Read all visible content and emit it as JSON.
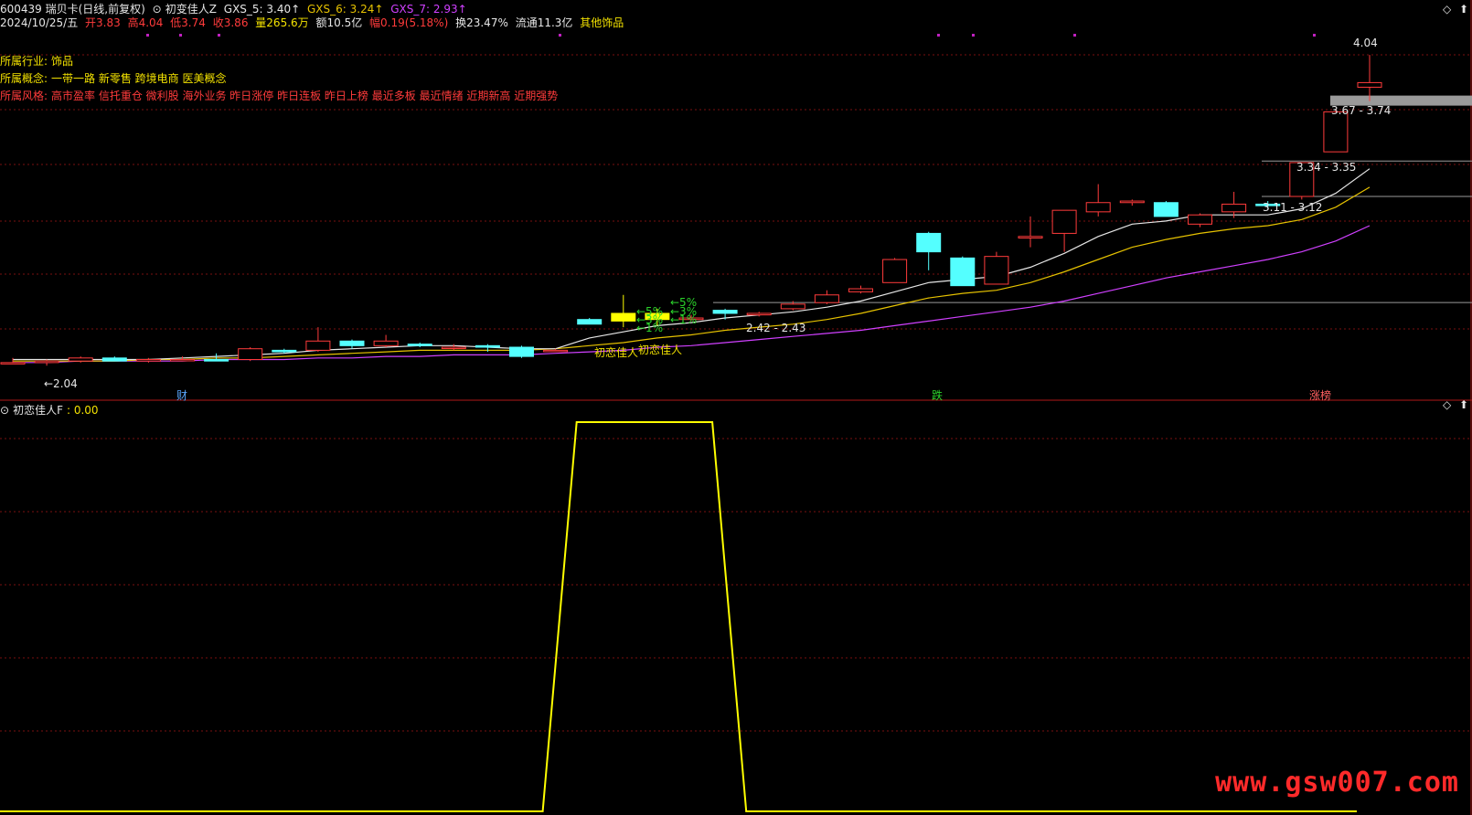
{
  "header": {
    "code_name": "600439 瑞贝卡(日线,前复权)",
    "indicator_name": "初变佳人Z",
    "gxs5": "GXS_5: 3.40↑",
    "gxs6": "GXS_6: 3.24↑",
    "gxs7": "GXS_7: 2.93↑",
    "date": "2024/10/25/五",
    "open": "开3.83",
    "high": "高4.04",
    "low": "低3.74",
    "close": "收3.86",
    "volume": "量265.6万",
    "amount": "额10.5亿",
    "change": "幅0.19(5.18%)",
    "turnover": "换23.47%",
    "float_cap": "流通11.3亿",
    "sector": "其他饰品"
  },
  "info": {
    "industry_label": "所属行业:",
    "industry": "饰品",
    "concept_label": "所属概念:",
    "concepts": "一带一路 新零售 跨境电商 医美概念",
    "style_label": "所属风格:",
    "styles": "高市盈率 信托重仓 微利股 海外业务 昨日涨停 昨日连板 昨日上榜 最近多板 最近情绪 近期新高 近期强势"
  },
  "annotations": {
    "price_top": "4.04",
    "price_low": "←2.04",
    "range_a": "3.67 - 3.74",
    "range_b": "3.34 - 3.35",
    "range_c": "3.11 - 3.12",
    "range_d": "2.42 - 2.43",
    "signal_label": "初恋佳人",
    "signal_label2": "初恋佳人",
    "pct_a": "←5%",
    "pct_b": "←3%",
    "pct_c": "←5%",
    "pct_d": "←3%",
    "pct_e": "←1%",
    "pct_f": "←1%",
    "marker_cai": "财",
    "marker_die": "跌",
    "marker_zhang": "涨榜"
  },
  "sub_panel": {
    "title": "初恋佳人F",
    "value": ": 0.00"
  },
  "watermark": "www.gsw007.com",
  "colors": {
    "up": "#ff3b3b",
    "down": "#54ffff",
    "signal": "#ffff00",
    "ma5": "#e6e6e6",
    "ma6": "#e6c200",
    "ma7": "#d040ff"
  },
  "chart_data": {
    "type": "candlestick",
    "price_range": [
      1.95,
      4.1
    ],
    "candles": [
      {
        "o": 2.04,
        "h": 2.07,
        "l": 2.03,
        "c": 2.04
      },
      {
        "o": 2.04,
        "h": 2.06,
        "l": 2.02,
        "c": 2.05
      },
      {
        "o": 2.05,
        "h": 2.08,
        "l": 2.04,
        "c": 2.07
      },
      {
        "o": 2.07,
        "h": 2.08,
        "l": 2.05,
        "c": 2.05
      },
      {
        "o": 2.05,
        "h": 2.07,
        "l": 2.04,
        "c": 2.06
      },
      {
        "o": 2.06,
        "h": 2.08,
        "l": 2.05,
        "c": 2.06
      },
      {
        "o": 2.06,
        "h": 2.1,
        "l": 2.05,
        "c": 2.05
      },
      {
        "o": 2.06,
        "h": 2.14,
        "l": 2.05,
        "c": 2.13
      },
      {
        "o": 2.12,
        "h": 2.13,
        "l": 2.1,
        "c": 2.11
      },
      {
        "o": 2.12,
        "h": 2.27,
        "l": 2.11,
        "c": 2.18
      },
      {
        "o": 2.18,
        "h": 2.19,
        "l": 2.13,
        "c": 2.15
      },
      {
        "o": 2.15,
        "h": 2.22,
        "l": 2.14,
        "c": 2.18
      },
      {
        "o": 2.16,
        "h": 2.17,
        "l": 2.14,
        "c": 2.15
      },
      {
        "o": 2.14,
        "h": 2.16,
        "l": 2.12,
        "c": 2.14
      },
      {
        "o": 2.15,
        "h": 2.16,
        "l": 2.11,
        "c": 2.14
      },
      {
        "o": 2.14,
        "h": 2.15,
        "l": 2.07,
        "c": 2.08
      },
      {
        "o": 2.12,
        "h": 2.13,
        "l": 2.12,
        "c": 2.12
      },
      {
        "o": 2.32,
        "h": 2.33,
        "l": 2.29,
        "c": 2.29
      },
      {
        "o": 2.36,
        "h": 2.48,
        "l": 2.27,
        "c": 2.31
      },
      {
        "o": 2.36,
        "h": 2.39,
        "l": 2.28,
        "c": 2.32
      },
      {
        "o": 2.32,
        "h": 2.35,
        "l": 2.31,
        "c": 2.33
      },
      {
        "o": 2.38,
        "h": 2.39,
        "l": 2.32,
        "c": 2.36
      },
      {
        "o": 2.35,
        "h": 2.37,
        "l": 2.34,
        "c": 2.36
      },
      {
        "o": 2.39,
        "h": 2.44,
        "l": 2.38,
        "c": 2.42
      },
      {
        "o": 2.43,
        "h": 2.51,
        "l": 2.42,
        "c": 2.48
      },
      {
        "o": 2.5,
        "h": 2.54,
        "l": 2.49,
        "c": 2.52
      },
      {
        "o": 2.56,
        "h": 2.72,
        "l": 2.56,
        "c": 2.71
      },
      {
        "o": 2.88,
        "h": 2.89,
        "l": 2.64,
        "c": 2.76
      },
      {
        "o": 2.72,
        "h": 2.73,
        "l": 2.54,
        "c": 2.54
      },
      {
        "o": 2.55,
        "h": 2.76,
        "l": 2.55,
        "c": 2.73
      },
      {
        "o": 2.85,
        "h": 2.99,
        "l": 2.79,
        "c": 2.86
      },
      {
        "o": 2.88,
        "h": 3.03,
        "l": 2.76,
        "c": 3.03
      },
      {
        "o": 3.02,
        "h": 3.2,
        "l": 2.99,
        "c": 3.08
      },
      {
        "o": 3.08,
        "h": 3.1,
        "l": 3.06,
        "c": 3.09
      },
      {
        "o": 3.08,
        "h": 3.09,
        "l": 2.99,
        "c": 2.99
      },
      {
        "o": 2.94,
        "h": 3.01,
        "l": 2.92,
        "c": 3.0
      },
      {
        "o": 3.02,
        "h": 3.15,
        "l": 2.98,
        "c": 3.07
      },
      {
        "o": 3.07,
        "h": 3.09,
        "l": 3.04,
        "c": 3.06
      },
      {
        "o": 3.12,
        "h": 3.34,
        "l": 3.1,
        "c": 3.34
      },
      {
        "o": 3.41,
        "h": 3.68,
        "l": 3.41,
        "c": 3.67
      },
      {
        "o": 3.83,
        "h": 4.04,
        "l": 3.74,
        "c": 3.86
      }
    ],
    "ma5": [
      2.06,
      2.06,
      2.06,
      2.06,
      2.06,
      2.07,
      2.08,
      2.09,
      2.1,
      2.12,
      2.13,
      2.14,
      2.15,
      2.15,
      2.14,
      2.13,
      2.13,
      2.2,
      2.24,
      2.28,
      2.3,
      2.33,
      2.35,
      2.37,
      2.4,
      2.44,
      2.5,
      2.56,
      2.58,
      2.6,
      2.66,
      2.75,
      2.86,
      2.94,
      2.96,
      3.0,
      3.0,
      3.0,
      3.04,
      3.14,
      3.3
    ],
    "ma6": [
      2.05,
      2.05,
      2.05,
      2.05,
      2.06,
      2.06,
      2.07,
      2.07,
      2.08,
      2.09,
      2.1,
      2.11,
      2.12,
      2.12,
      2.12,
      2.12,
      2.13,
      2.15,
      2.17,
      2.2,
      2.22,
      2.25,
      2.27,
      2.29,
      2.32,
      2.36,
      2.41,
      2.46,
      2.49,
      2.51,
      2.56,
      2.63,
      2.71,
      2.79,
      2.84,
      2.88,
      2.91,
      2.93,
      2.97,
      3.05,
      3.18
    ],
    "ma7": [
      2.04,
      2.04,
      2.05,
      2.05,
      2.05,
      2.05,
      2.06,
      2.06,
      2.06,
      2.07,
      2.07,
      2.08,
      2.08,
      2.09,
      2.09,
      2.09,
      2.1,
      2.11,
      2.12,
      2.14,
      2.15,
      2.17,
      2.19,
      2.21,
      2.23,
      2.25,
      2.28,
      2.31,
      2.34,
      2.37,
      2.4,
      2.44,
      2.49,
      2.54,
      2.59,
      2.63,
      2.67,
      2.71,
      2.76,
      2.83,
      2.93
    ],
    "signal_f": [
      0,
      0,
      0,
      0,
      0,
      0,
      0,
      0,
      0,
      0,
      0,
      0,
      0,
      0,
      0,
      0,
      0,
      1,
      1,
      1,
      1,
      1,
      0,
      0,
      0,
      0,
      0,
      0,
      0,
      0,
      0,
      0,
      0,
      0,
      0,
      0,
      0,
      0,
      0,
      0,
      0
    ],
    "level_lines": [
      3.74,
      3.35,
      3.12,
      2.43
    ]
  }
}
